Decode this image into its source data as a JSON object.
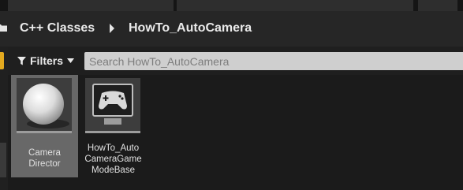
{
  "breadcrumb": {
    "items": [
      {
        "label": "C++ Classes"
      },
      {
        "label": "HowTo_AutoCamera"
      }
    ]
  },
  "filters": {
    "label": "Filters"
  },
  "search": {
    "placeholder": "Search HowTo_AutoCamera"
  },
  "assets": [
    {
      "label": "Camera\nDirector",
      "icon": "sphere-icon",
      "selected": true
    },
    {
      "label": "HowTo_Auto\nCameraGame\nModeBase",
      "icon": "gamepad-icon",
      "selected": false
    }
  ],
  "colors": {
    "accent": "#e3a91f",
    "selection": "#686868",
    "search_bg": "#cfcfcf"
  }
}
